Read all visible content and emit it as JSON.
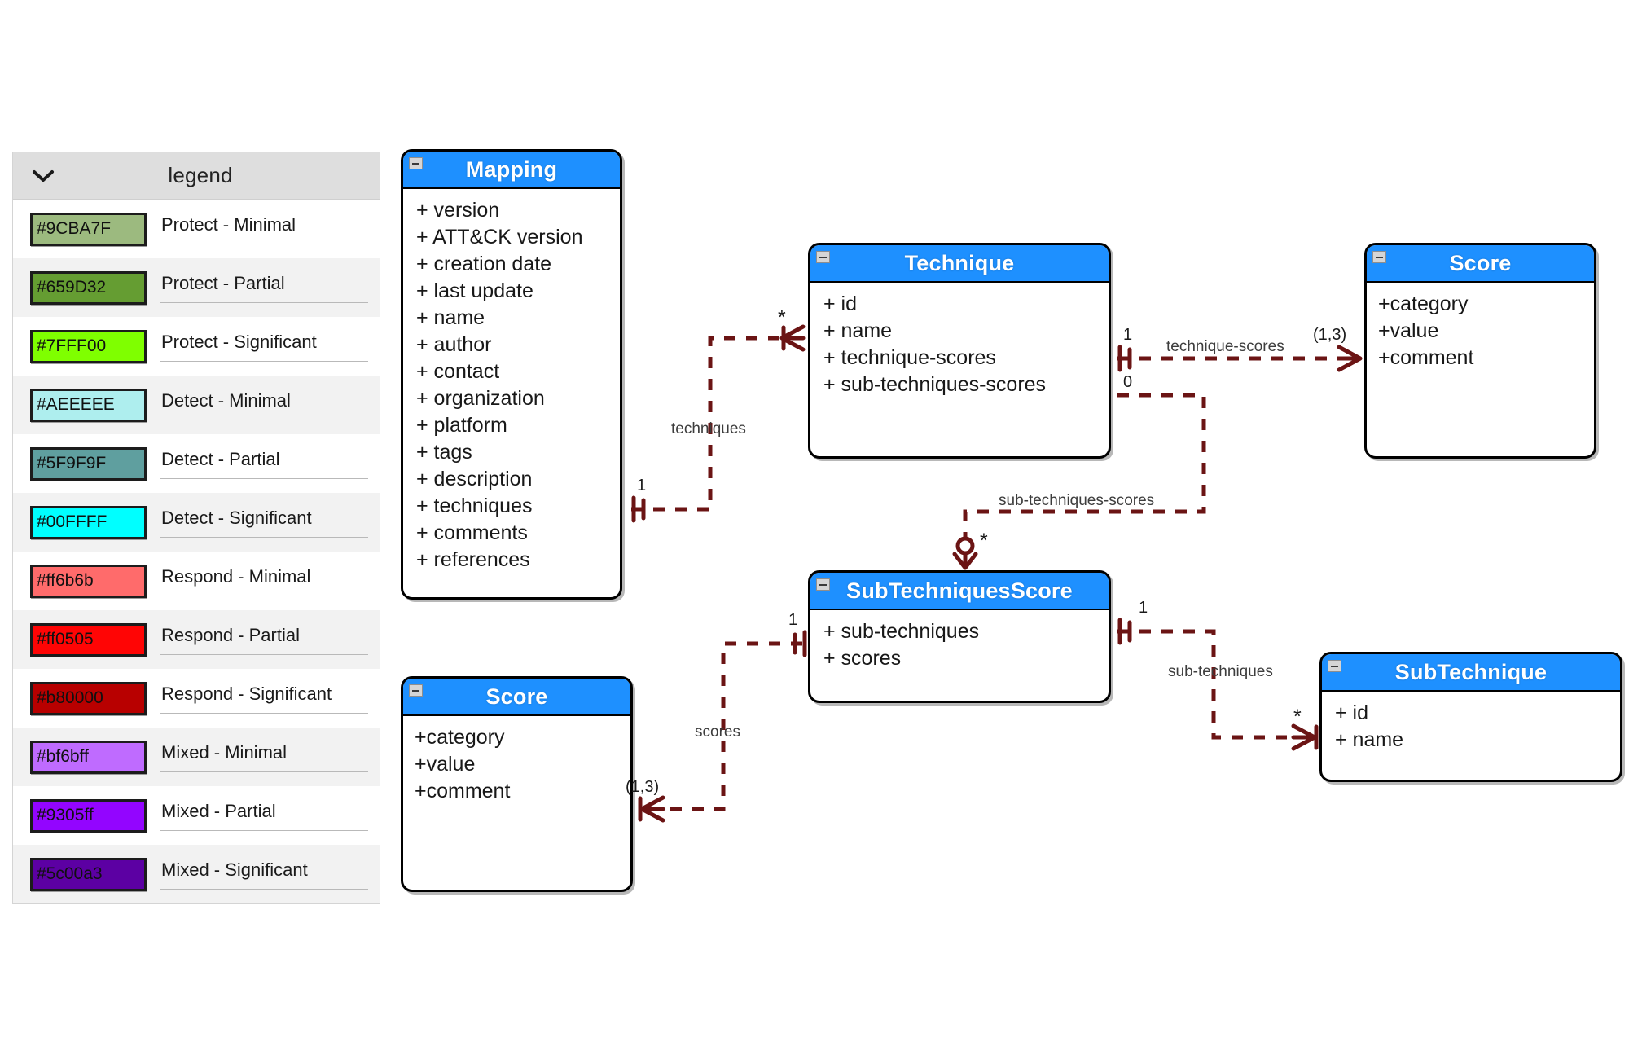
{
  "legend": {
    "title": "legend",
    "caret_icon": "chevron-down-icon",
    "items": [
      {
        "color": "#9CBA7F",
        "code": "#9CBA7F",
        "label": "Protect - Minimal"
      },
      {
        "color": "#659D32",
        "code": "#659D32",
        "label": "Protect - Partial"
      },
      {
        "color": "#7FFF00",
        "code": "#7FFF00",
        "label": "Protect - Significant"
      },
      {
        "color": "#AEEEEE",
        "code": "#AEEEEE",
        "label": "Detect - Minimal"
      },
      {
        "color": "#5F9F9F",
        "code": "#5F9F9F",
        "label": "Detect - Partial"
      },
      {
        "color": "#00FFFF",
        "code": "#00FFFF",
        "label": "Detect - Significant"
      },
      {
        "color": "#ff6b6b",
        "code": "#ff6b6b",
        "label": "Respond - Minimal"
      },
      {
        "color": "#ff0505",
        "code": "#ff0505",
        "label": "Respond - Partial"
      },
      {
        "color": "#b80000",
        "code": "#b80000",
        "label": "Respond - Significant"
      },
      {
        "color": "#bf6bff",
        "code": "#bf6bff",
        "label": "Mixed - Minimal"
      },
      {
        "color": "#9305ff",
        "code": "#9305ff",
        "label": "Mixed - Partial"
      },
      {
        "color": "#5c00a3",
        "code": "#5c00a3",
        "label": "Mixed - Significant"
      }
    ]
  },
  "diagram": {
    "header_color": "#1e90ff",
    "edge_color": "#6b1414",
    "classes": {
      "mapping": {
        "title": "Mapping",
        "collapse_icon": "collapse-minus-icon",
        "attributes": [
          "+ version",
          "+ ATT&CK version",
          "+ creation date",
          "+ last update",
          "+ name",
          "+ author",
          "+ contact",
          "+ organization",
          "+ platform",
          "+ tags",
          "+ description",
          "+ techniques",
          "+ comments",
          "+ references"
        ]
      },
      "technique": {
        "title": "Technique",
        "collapse_icon": "collapse-minus-icon",
        "attributes": [
          "+ id",
          "+ name",
          "+ technique-scores",
          "+ sub-techniques-scores"
        ]
      },
      "score_top": {
        "title": "Score",
        "collapse_icon": "collapse-minus-icon",
        "attributes": [
          "+category",
          "+value",
          "+comment"
        ]
      },
      "subtechniquesscore": {
        "title": "SubTechniquesScore",
        "collapse_icon": "collapse-minus-icon",
        "attributes": [
          "+ sub-techniques",
          "+ scores"
        ]
      },
      "subtechnique": {
        "title": "SubTechnique",
        "collapse_icon": "collapse-minus-icon",
        "attributes": [
          "+ id",
          "+ name"
        ]
      },
      "score_bottom": {
        "title": "Score",
        "collapse_icon": "collapse-minus-icon",
        "attributes": [
          "+category",
          "+value",
          "+comment"
        ]
      }
    },
    "relationships": {
      "techniques": {
        "label": "techniques",
        "source_card": "1",
        "target_card": "*"
      },
      "technique_scores": {
        "label": "technique-scores",
        "source_card": "1",
        "target_card": "(1,3)"
      },
      "sub_techniques_scores": {
        "label": "sub-techniques-scores",
        "source_card": "0",
        "target_card": "*"
      },
      "scores": {
        "label": "scores",
        "source_card": "1",
        "target_card": "(1,3)"
      },
      "sub_techniques": {
        "label": "sub-techniques",
        "source_card": "1",
        "target_card": "*"
      }
    }
  }
}
